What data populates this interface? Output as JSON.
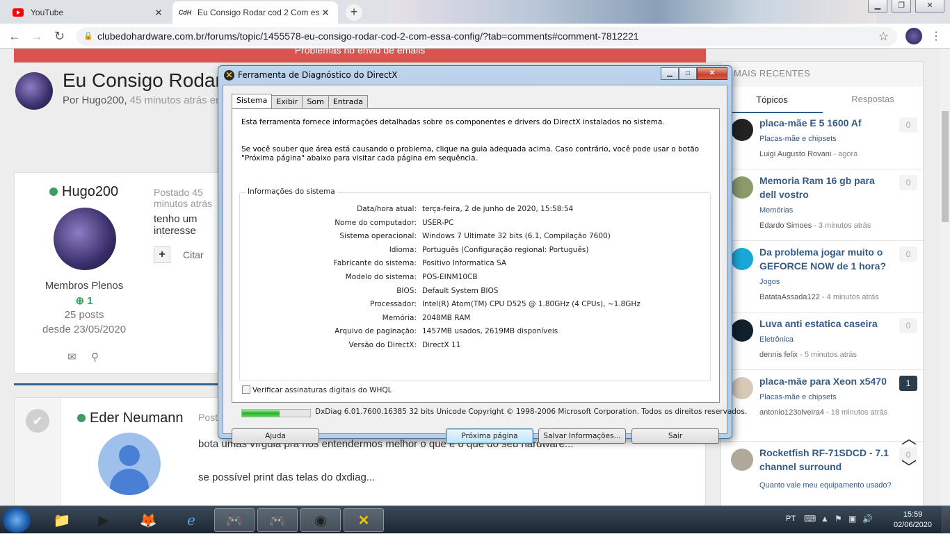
{
  "browser": {
    "tabs": [
      {
        "title": "YouTube",
        "icon": "youtube-icon"
      },
      {
        "title": "Eu Consigo Rodar cod 2 Com essa",
        "icon": "cdh-icon",
        "icon_text": "CdH"
      }
    ],
    "url": "clubedohardware.com.br/forums/topic/1455578-eu-consigo-rodar-cod-2-com-essa-config/?tab=comments#comment-7812221"
  },
  "page": {
    "alert": "Problemas no envio de emails",
    "topic_title": "Eu Consigo Rodar cod 2 Com essa config?",
    "topic_by": "Por Hugo200,",
    "topic_time": "45 minutos atrás em",
    "post1": {
      "author": "Hugo200",
      "group": "Membros Plenos",
      "rep": "1",
      "posts": "25 posts",
      "since": "desde 23/05/2020",
      "posted": "Postado 45 minutos atrás",
      "body": "tenho um interesse",
      "citar": "Citar"
    },
    "post2": {
      "author": "Eder Neumann",
      "posted": "Postado",
      "line1": "bota umas vírgula pra nós entendermos melhor o que é o que do seu hardware...",
      "line2": "se possível print das telas do dxdiag..."
    }
  },
  "sidebar": {
    "header": "MAIS RECENTES",
    "tab_active": "Tópicos",
    "tab_inactive": "Respostas",
    "items": [
      {
        "title": "placa-mãe E 5 1600 Af",
        "forum": "Placas-mãe e chipsets",
        "user": "Luigi Augusto Rovani",
        "time": "- agora",
        "count": "0"
      },
      {
        "title": "Memoria Ram 16 gb para dell vostro",
        "forum": "Memórias",
        "user": "Edardo Simoes",
        "time": "- 3 minutos atrás",
        "count": "0"
      },
      {
        "title": "Da problema jogar muito o GEFORCE NOW de 1 hora?",
        "forum": "Jogos",
        "user": "BatataAssada122",
        "time": "- 4 minutos atrás",
        "count": "0"
      },
      {
        "title": "Luva anti estatica caseira",
        "forum": "Eletrônica",
        "user": "dennis felix",
        "time": "- 5 minutos atrás",
        "count": "0"
      },
      {
        "title": "placa-mãe para Xeon x5470",
        "forum": "Placas-mãe e chipsets",
        "user": "antonio123olveira4",
        "time": "- 18 minutos atrás",
        "count": "1"
      },
      {
        "title": "Rocketfish RF-71SDCD - 7.1 channel surround",
        "forum": "Quanto vale meu equipamento usado?",
        "user": "",
        "time": "",
        "count": "0"
      }
    ]
  },
  "dialog": {
    "title": "Ferramenta de Diagnóstico do DirectX",
    "tabs": [
      "Sistema",
      "Exibir",
      "Som",
      "Entrada"
    ],
    "intro1": "Esta ferramenta fornece informações detalhadas sobre os componentes e drivers do DirectX instalados no sistema.",
    "intro2": "Se você souber que área está causando o problema, clique na guia adequada acima. Caso contrário, você pode usar o botão \"Próxima página\" abaixo para visitar cada página em sequência.",
    "group_label": "Informações do sistema",
    "rows": [
      {
        "k": "Data/hora atual:",
        "v": "terça-feira, 2 de junho de 2020, 15:58:54"
      },
      {
        "k": "Nome do computador:",
        "v": "USER-PC"
      },
      {
        "k": "Sistema operacional:",
        "v": "Windows 7 Ultimate 32 bits (6.1, Compilação 7600)"
      },
      {
        "k": "Idioma:",
        "v": "Português (Configuração regional: Português)"
      },
      {
        "k": "Fabricante do sistema:",
        "v": "Positivo Informatica SA"
      },
      {
        "k": "Modelo do sistema:",
        "v": "POS-EINM10CB"
      },
      {
        "k": "BIOS:",
        "v": "Default System BIOS"
      },
      {
        "k": "Processador:",
        "v": "Intel(R) Atom(TM) CPU D525   @ 1.80GHz (4 CPUs), ~1.8GHz"
      },
      {
        "k": "Memória:",
        "v": "2048MB RAM"
      },
      {
        "k": "Arquivo de paginação:",
        "v": "1457MB usados, 2619MB disponíveis"
      },
      {
        "k": "Versão do DirectX:",
        "v": "DirectX 11"
      }
    ],
    "whql": "Verificar assinaturas digitais do WHQL",
    "progress": 0.55,
    "copyright": "DxDiag 6.01.7600.16385 32 bits Unicode  Copyright © 1998-2006 Microsoft Corporation.  Todos os direitos reservados.",
    "buttons": {
      "help": "Ajuda",
      "next": "Próxima página",
      "save": "Salvar Informações...",
      "exit": "Sair"
    }
  },
  "taskbar": {
    "lang": "PT",
    "time": "15:59",
    "date": "02/06/2020"
  }
}
